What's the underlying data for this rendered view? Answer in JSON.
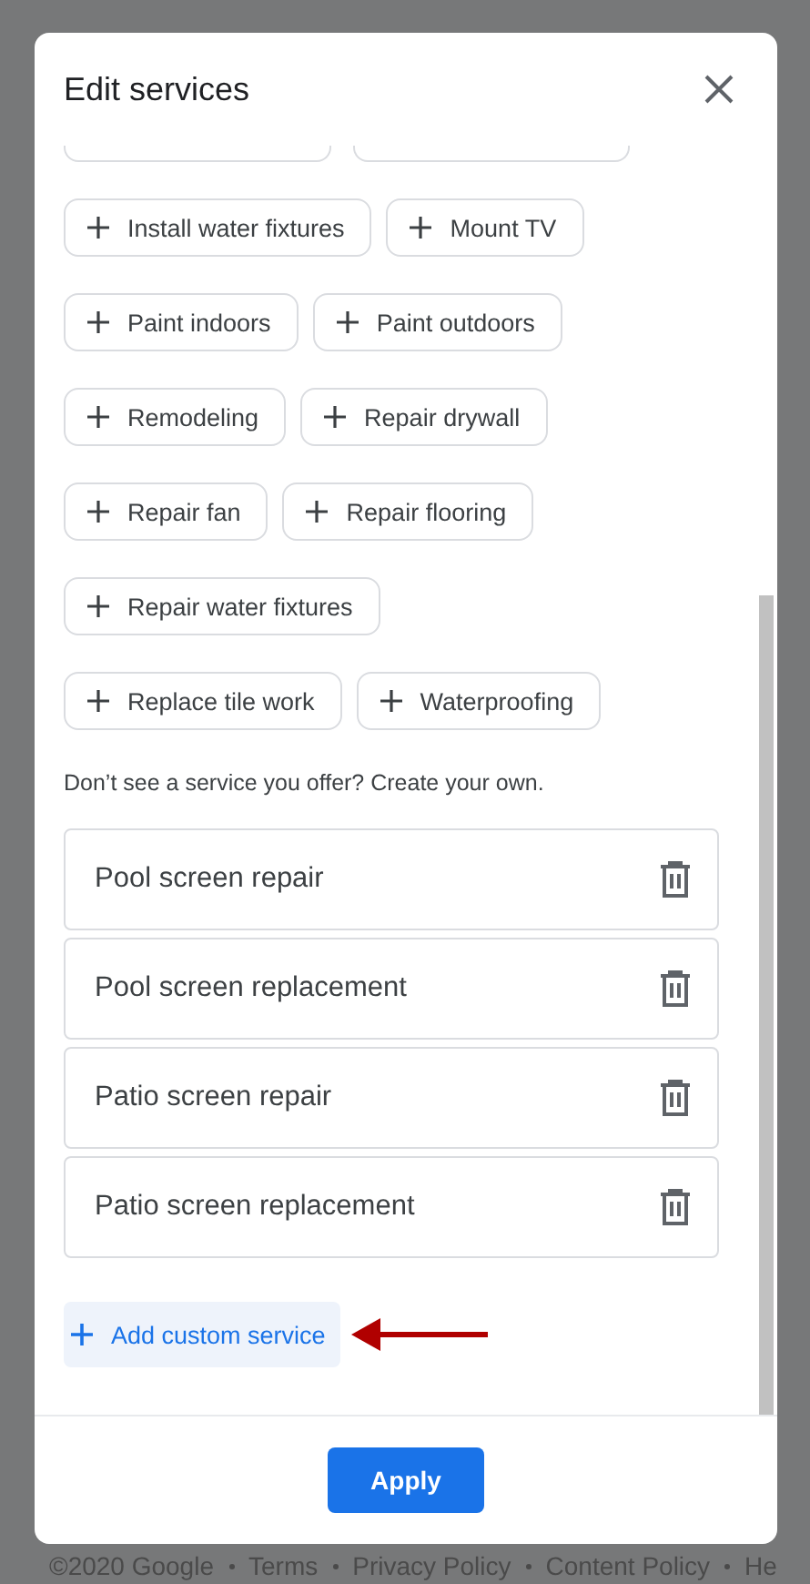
{
  "background_footer": {
    "links": [
      "©2020 Google",
      "Terms",
      "Privacy Policy",
      "Content Policy",
      "He"
    ]
  },
  "dialog": {
    "title": "Edit services",
    "chips": [
      {
        "label": "Install water fixtures"
      },
      {
        "label": "Mount TV"
      },
      {
        "label": "Paint indoors"
      },
      {
        "label": "Paint outdoors"
      },
      {
        "label": "Remodeling"
      },
      {
        "label": "Repair drywall"
      },
      {
        "label": "Repair fan"
      },
      {
        "label": "Repair flooring"
      },
      {
        "label": "Repair water fixtures"
      },
      {
        "label": "Replace tile work"
      },
      {
        "label": "Waterproofing"
      }
    ],
    "prompt": "Don’t see a service you offer? Create your own.",
    "custom_services": [
      {
        "name": "Pool screen repair"
      },
      {
        "name": "Pool screen replacement"
      },
      {
        "name": "Patio screen repair"
      },
      {
        "name": "Patio screen replacement"
      }
    ],
    "add_button": "Add custom service",
    "apply_button": "Apply"
  }
}
